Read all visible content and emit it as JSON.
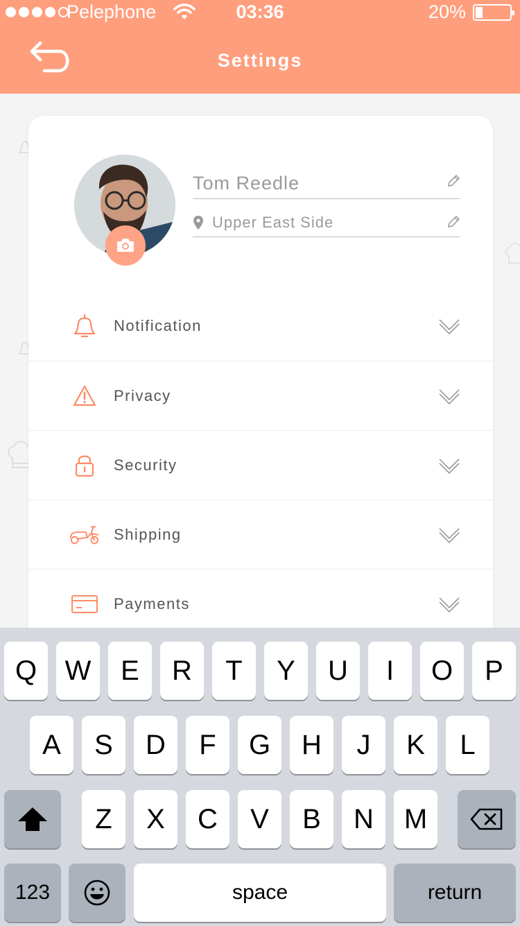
{
  "status_bar": {
    "carrier": "Pelephone",
    "time": "03:36",
    "battery_percent_label": "20%",
    "battery_level": 0.2,
    "signal_strength": 4
  },
  "header": {
    "title": "Settings",
    "back_icon": "back-arrow-icon",
    "background_color": "#ff9e7d"
  },
  "profile": {
    "name": "Tom Reedle",
    "location": "Upper East Side",
    "camera_icon": "camera-icon",
    "edit_icon": "pencil-icon",
    "location_icon": "location-pin-icon"
  },
  "menu": {
    "accent_color": "#ff8a65",
    "items": [
      {
        "label": "Notification",
        "icon": "bell-icon"
      },
      {
        "label": "Privacy",
        "icon": "warning-icon"
      },
      {
        "label": "Security",
        "icon": "lock-icon"
      },
      {
        "label": "Shipping",
        "icon": "scooter-icon"
      },
      {
        "label": "Payments",
        "icon": "credit-card-icon"
      }
    ]
  },
  "keyboard": {
    "row1": [
      "Q",
      "W",
      "E",
      "R",
      "T",
      "Y",
      "U",
      "I",
      "O",
      "P"
    ],
    "row2": [
      "A",
      "S",
      "D",
      "F",
      "G",
      "H",
      "J",
      "K",
      "L"
    ],
    "row3": [
      "Z",
      "X",
      "C",
      "V",
      "B",
      "N",
      "M"
    ],
    "numbers_label": "123",
    "space_label": "space",
    "return_label": "return",
    "shift_icon": "shift-icon",
    "delete_icon": "backspace-icon",
    "emoji_icon": "emoji-icon"
  }
}
